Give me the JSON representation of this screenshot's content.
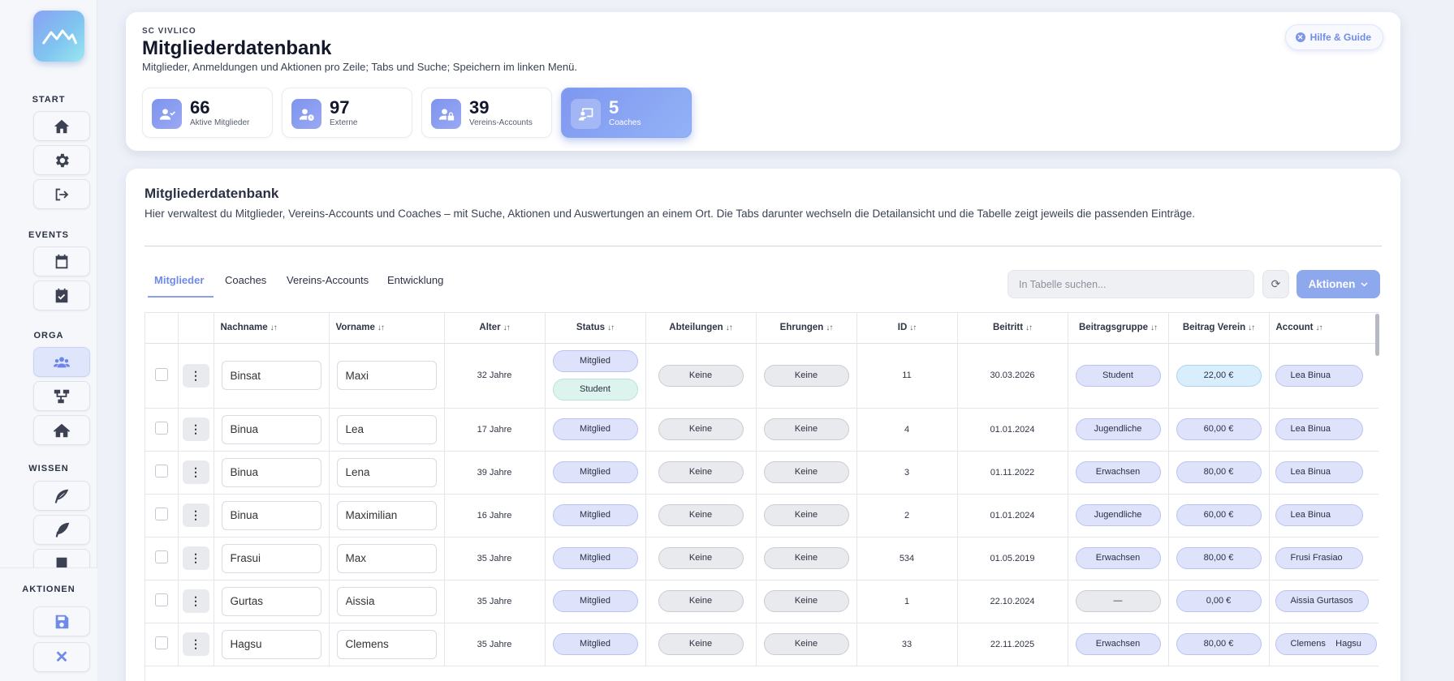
{
  "sidebar": {
    "sections": {
      "start": "START",
      "events": "EVENTS",
      "orga": "ORGA",
      "wissen": "WISSEN",
      "aktionen": "AKTIONEN"
    }
  },
  "header": {
    "club": "SC VIVLICO",
    "title": "Mitgliederdatenbank",
    "subtitle": "Mitglieder, Anmeldungen und Aktionen pro Zeile; Tabs und Suche; Speichern im linken Menü.",
    "help_label": "Hilfe & Guide",
    "stats": [
      {
        "value": "66",
        "label": "Aktive Mitglieder"
      },
      {
        "value": "97",
        "label": "Externe"
      },
      {
        "value": "39",
        "label": "Vereins-Accounts"
      },
      {
        "value": "5",
        "label": "Coaches"
      }
    ]
  },
  "main": {
    "title": "Mitgliederdatenbank",
    "description": "Hier verwaltest du Mitglieder, Vereins-Accounts und Coaches – mit Suche, Aktionen und Auswertungen an einem Ort. Die Tabs darunter wechseln die Detailansicht und die Tabelle zeigt jeweils die passenden Einträge.",
    "tabs": [
      "Mitglieder",
      "Coaches",
      "Vereins-Accounts",
      "Entwicklung"
    ],
    "search_placeholder": "In Tabelle suchen...",
    "actions_label": "Aktionen"
  },
  "table": {
    "columns": [
      "Nachname",
      "Vorname",
      "Alter",
      "Status",
      "Abteilungen",
      "Ehrungen",
      "ID",
      "Beitritt",
      "Beitragsgruppe",
      "Beitrag Verein",
      "Account"
    ],
    "rows": [
      {
        "nachname": "Binsat",
        "vorname": "Maxi",
        "alter": "32 Jahre",
        "status": "Mitglied",
        "status2": "Student",
        "abteilungen": "Keine",
        "ehrungen": "Keine",
        "id": "11",
        "beitritt": "30.03.2026",
        "gruppe": "Student",
        "beitrag": "22,00 €",
        "account": "Lea Binua"
      },
      {
        "nachname": "Binua",
        "vorname": "Lea",
        "alter": "17 Jahre",
        "status": "Mitglied",
        "abteilungen": "Keine",
        "ehrungen": "Keine",
        "id": "4",
        "beitritt": "01.01.2024",
        "gruppe": "Jugendliche",
        "beitrag": "60,00 €",
        "account": "Lea Binua"
      },
      {
        "nachname": "Binua",
        "vorname": "Lena",
        "alter": "39 Jahre",
        "status": "Mitglied",
        "abteilungen": "Keine",
        "ehrungen": "Keine",
        "id": "3",
        "beitritt": "01.11.2022",
        "gruppe": "Erwachsen",
        "beitrag": "80,00 €",
        "account": "Lea Binua"
      },
      {
        "nachname": "Binua",
        "vorname": "Maximilian",
        "alter": "16 Jahre",
        "status": "Mitglied",
        "abteilungen": "Keine",
        "ehrungen": "Keine",
        "id": "2",
        "beitritt": "01.01.2024",
        "gruppe": "Jugendliche",
        "beitrag": "60,00 €",
        "account": "Lea Binua"
      },
      {
        "nachname": "Frasui",
        "vorname": "Max",
        "alter": "35 Jahre",
        "status": "Mitglied",
        "abteilungen": "Keine",
        "ehrungen": "Keine",
        "id": "534",
        "beitritt": "01.05.2019",
        "gruppe": "Erwachsen",
        "beitrag": "80,00 €",
        "account": "Frusi Frasiao"
      },
      {
        "nachname": "Gurtas",
        "vorname": "Aissia",
        "alter": "35 Jahre",
        "status": "Mitglied",
        "abteilungen": "Keine",
        "ehrungen": "Keine",
        "id": "1",
        "beitritt": "22.10.2024",
        "gruppe": "—",
        "beitrag": "0,00 €",
        "account": "Aissia Gurtasos"
      },
      {
        "nachname": "Hagsu",
        "vorname": "Clemens",
        "alter": "35 Jahre",
        "status": "Mitglied",
        "abteilungen": "Keine",
        "ehrungen": "Keine",
        "id": "33",
        "beitritt": "22.11.2025",
        "gruppe": "Erwachsen",
        "beitrag": "80,00 €",
        "account": "Clemens    Hagsu"
      }
    ]
  },
  "colors": {
    "accent": "#7f97f0",
    "status_pill": "#dee2fb",
    "student_pill": "#dcf3ee"
  }
}
